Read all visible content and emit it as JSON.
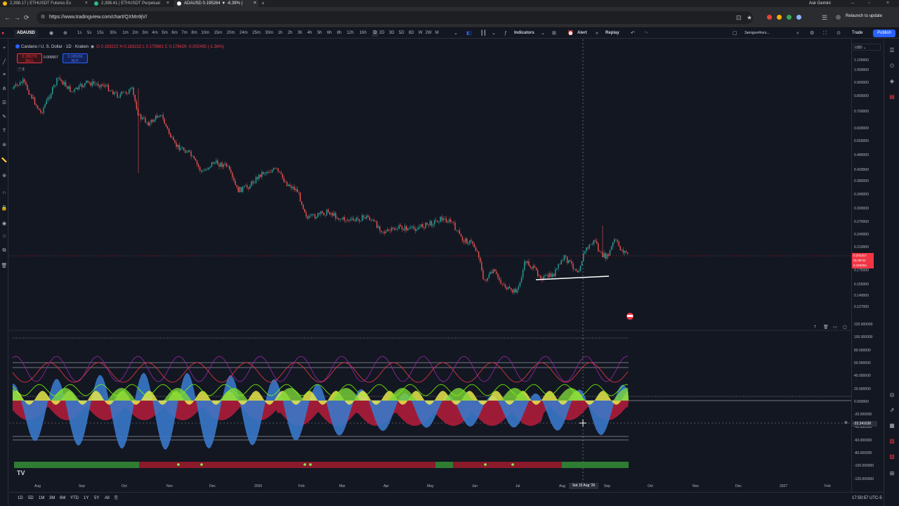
{
  "browser": {
    "tabs": [
      {
        "title": "2,398.17 | ETHUSDT Futures Ex"
      },
      {
        "title": "2,398.41 | ETHUSDT Perpetual"
      },
      {
        "title": "ADAUSD 0.195264 ▼ -6.39% |"
      }
    ],
    "url": "https://www.tradingview.com/chart/QXMn9jV/",
    "ask_gemini": "Ask Gemini",
    "relaunch": "Relaunch to update"
  },
  "toolbar": {
    "symbol": "ADAUSD",
    "intervals": [
      "1s",
      "5s",
      "15s",
      "30s",
      "1m",
      "2m",
      "3m",
      "4m",
      "5m",
      "6m",
      "7m",
      "8m",
      "10m",
      "15m",
      "20m",
      "24m",
      "25m",
      "30m",
      "1h",
      "2h",
      "3h",
      "4h",
      "5h",
      "6h",
      "8h",
      "12h",
      "16h",
      "D",
      "2D",
      "3D",
      "5D",
      "8D",
      "W",
      "2W",
      "M"
    ],
    "active_interval": "D",
    "indicators": "Indicators",
    "alert": "Alert",
    "replay": "Replay",
    "account": "3amigos4hors...",
    "trade": "Trade",
    "publish": "Publish"
  },
  "legend": {
    "title": "Cardano / U. S. Dollar · 1D · Kraken",
    "open": "O 0.183222",
    "high": "H 0.183222",
    "low": "L 0.175681",
    "close": "C 0.178426",
    "change": "-0.002492 (-1.36%)",
    "sell_price": "0.195279",
    "sell_label": "SELL",
    "spread": "0.000007",
    "buy_price": "0.195266",
    "buy_label": "BUY",
    "collapsed_count": "3"
  },
  "price_scale": {
    "currency": "USD",
    "labels": [
      "1.100000",
      "1.000000",
      "0.900000",
      "0.800000",
      "0.700000",
      "0.600000",
      "0.550000",
      "0.480000",
      "0.420000",
      "0.380000",
      "0.340000",
      "0.300000",
      "0.270000",
      "0.240000",
      "0.210000",
      "0.175000",
      "0.155000",
      "0.140000",
      "0.127000"
    ],
    "last_price": "0.201317",
    "countdown": "01:09:02",
    "bid": "0.193264"
  },
  "osc_scale": {
    "labels": [
      "120.000000",
      "100.000000",
      "80.000000",
      "60.000000",
      "40.000000",
      "20.000000",
      "0.000000",
      "-20.000000",
      "-40.000000",
      "-60.000000",
      "-80.000000",
      "-100.000000",
      "-120.000000"
    ],
    "cursor_value": "-33.341630"
  },
  "time_axis": {
    "labels": [
      "Aug",
      "Sep",
      "Oct",
      "Nov",
      "Dec",
      "2026",
      "Feb",
      "Mar",
      "Apr",
      "May",
      "Jun",
      "Jul",
      "Aug",
      "Sep",
      "Oct",
      "Nov",
      "Dec",
      "2027",
      "Feb"
    ],
    "crosshair": "Sat 15 Aug '26"
  },
  "bottom": {
    "ranges": [
      "1D",
      "5D",
      "1M",
      "3M",
      "6M",
      "YTD",
      "1Y",
      "5Y",
      "All"
    ],
    "clock": "17:50:57 UTC-5"
  },
  "colors": {
    "bg": "#131722",
    "up": "#26a69a",
    "down": "#ef5350",
    "accent": "#2962ff"
  }
}
